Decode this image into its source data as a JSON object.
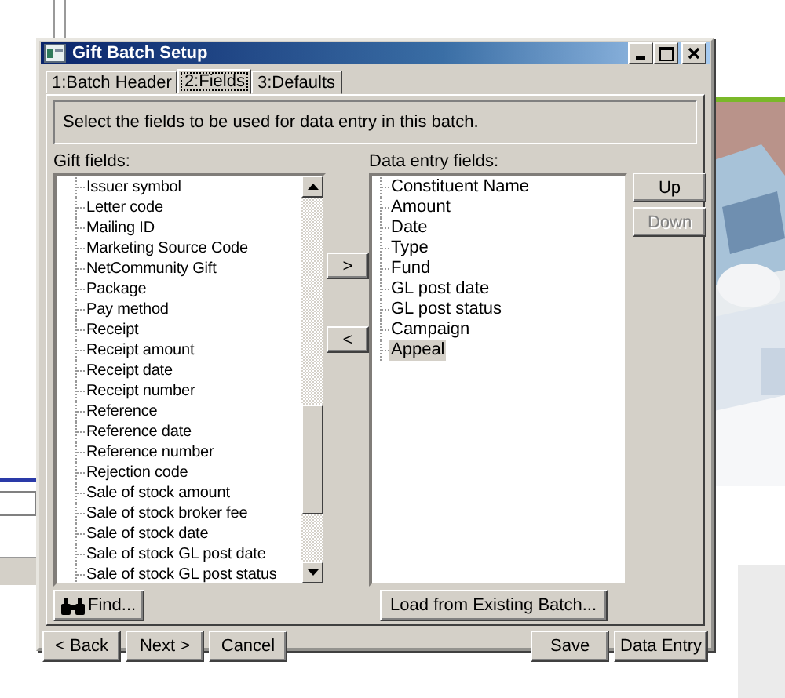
{
  "window": {
    "title": "Gift Batch Setup"
  },
  "tabs": [
    {
      "label": "1:Batch Header",
      "selected": false
    },
    {
      "label": "2:Fields",
      "selected": true
    },
    {
      "label": "3:Defaults",
      "selected": false
    }
  ],
  "instruction": "Select the fields to be used for data entry in this batch.",
  "gift_fields": {
    "label": "Gift fields:",
    "items": [
      {
        "label": "Issuer symbol",
        "selected": false
      },
      {
        "label": "Letter code",
        "selected": false
      },
      {
        "label": "Mailing ID",
        "selected": false
      },
      {
        "label": "Marketing Source Code",
        "selected": false
      },
      {
        "label": "NetCommunity Gift",
        "selected": false
      },
      {
        "label": "Package",
        "selected": false
      },
      {
        "label": "Pay method",
        "selected": false
      },
      {
        "label": "Receipt",
        "selected": false
      },
      {
        "label": "Receipt amount",
        "selected": false
      },
      {
        "label": "Receipt date",
        "selected": false
      },
      {
        "label": "Receipt number",
        "selected": false
      },
      {
        "label": "Reference",
        "selected": false
      },
      {
        "label": "Reference date",
        "selected": false
      },
      {
        "label": "Reference number",
        "selected": false
      },
      {
        "label": "Rejection code",
        "selected": false
      },
      {
        "label": "Sale of stock amount",
        "selected": false
      },
      {
        "label": "Sale of stock broker fee",
        "selected": false
      },
      {
        "label": "Sale of stock date",
        "selected": false
      },
      {
        "label": "Sale of stock GL post date",
        "selected": false
      },
      {
        "label": "Sale of stock GL post status",
        "selected": false
      }
    ]
  },
  "move_buttons": [
    ">",
    "<"
  ],
  "data_entry_fields": {
    "label": "Data entry fields:",
    "items": [
      {
        "label": "Constituent Name",
        "selected": false
      },
      {
        "label": "Amount",
        "selected": false
      },
      {
        "label": "Date",
        "selected": false
      },
      {
        "label": "Type",
        "selected": false
      },
      {
        "label": "Fund",
        "selected": false
      },
      {
        "label": "GL post date",
        "selected": false
      },
      {
        "label": "GL post status",
        "selected": false
      },
      {
        "label": "Campaign",
        "selected": false
      },
      {
        "label": "Appeal",
        "selected": true
      }
    ]
  },
  "order_buttons": [
    {
      "label": "Up",
      "disabled": false
    },
    {
      "label": "Down",
      "disabled": true
    }
  ],
  "find_button": "Find...",
  "load_button": "Load from Existing Batch...",
  "footer_left": [
    "< Back",
    "Next >",
    "Cancel"
  ],
  "footer_right": [
    "Save",
    "Data Entry"
  ]
}
